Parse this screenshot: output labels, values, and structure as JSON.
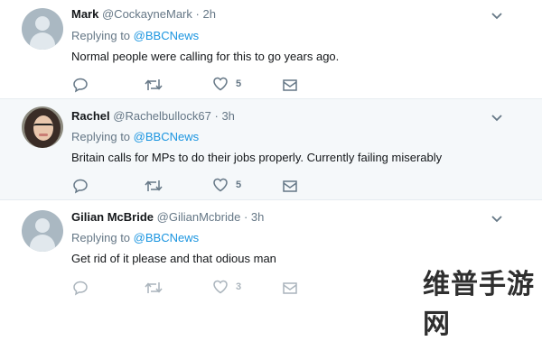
{
  "tweets": [
    {
      "name": "Mark",
      "handle": "@CockayneMark",
      "sep": "·",
      "time": "2h",
      "reply_prefix": "Replying to",
      "reply_to": "@BBCNews",
      "text": "Normal people were calling for this to go years ago.",
      "likes": "5"
    },
    {
      "name": "Rachel",
      "handle": "@Rachelbullock67",
      "sep": "·",
      "time": "3h",
      "reply_prefix": "Replying to",
      "reply_to": "@BBCNews",
      "text": "Britain calls for MPs to do their jobs properly.  Currently failing miserably",
      "likes": "5"
    },
    {
      "name": "Gilian McBride",
      "handle": "@GilianMcbride",
      "sep": "·",
      "time": "3h",
      "reply_prefix": "Replying to",
      "reply_to": "@BBCNews",
      "text": "Get rid of it please and that odious man",
      "likes": "3"
    }
  ],
  "icons": {
    "reply": "reply-icon",
    "retweet": "retweet-icon",
    "like": "heart-icon",
    "dm": "envelope-icon",
    "more": "chevron-down-icon"
  },
  "colors": {
    "link": "#1b95e0",
    "muted": "#657786",
    "divider": "#e6ecf0",
    "highlight_bg": "#f5f8fa"
  },
  "watermark": "维普手游网"
}
